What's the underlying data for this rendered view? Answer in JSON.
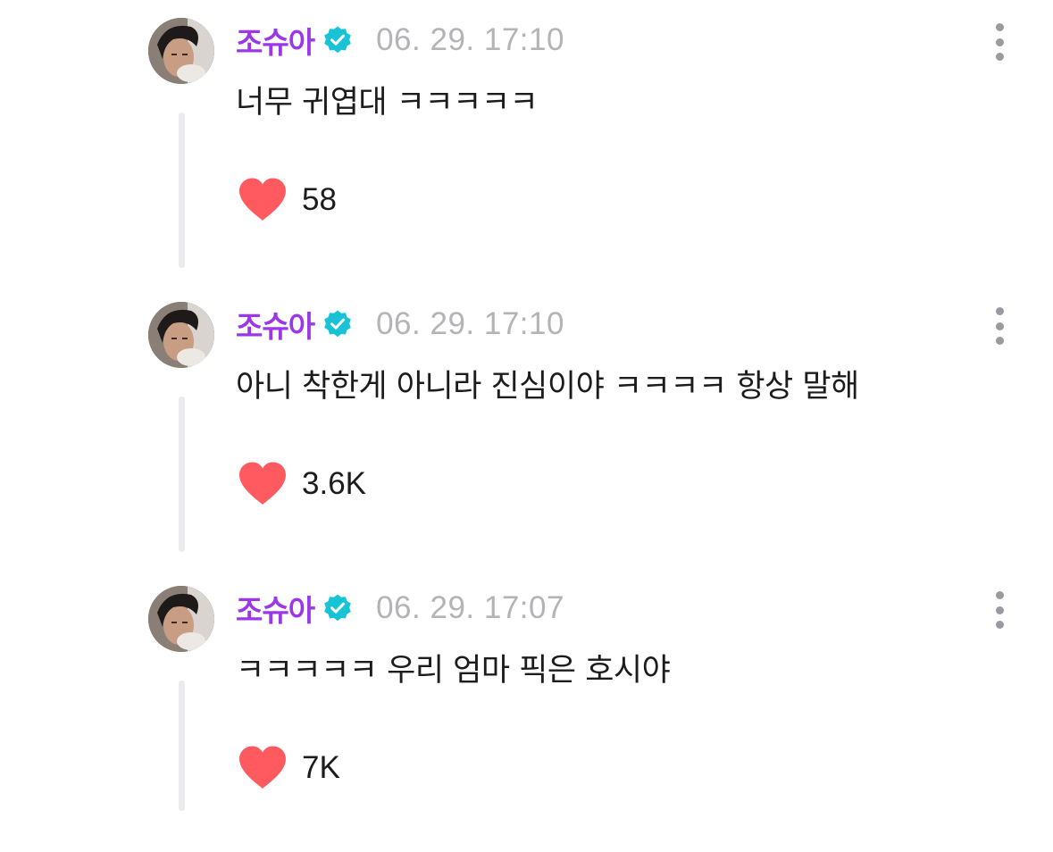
{
  "colors": {
    "author": "#9b37e8",
    "verified_badge": "#19c3d6",
    "timestamp": "#b3b3b8",
    "heart": "#ff5a5f",
    "thread_line": "#ececf0"
  },
  "icons": {
    "verified": "verified-badge-icon",
    "like": "heart-icon",
    "more": "more-vertical-icon"
  },
  "comments": [
    {
      "author": "조슈아",
      "timestamp": "06. 29. 17:10",
      "text": "너무 귀엽대 ㅋㅋㅋㅋㅋ",
      "likes": "58"
    },
    {
      "author": "조슈아",
      "timestamp": "06. 29. 17:10",
      "text": "아니 착한게 아니라 진심이야 ㅋㅋㅋㅋ 항상 말해",
      "likes": "3.6K"
    },
    {
      "author": "조슈아",
      "timestamp": "06. 29. 17:07",
      "text": "ㅋㅋㅋㅋㅋ 우리 엄마 픽은 호시야",
      "likes": "7K"
    }
  ]
}
